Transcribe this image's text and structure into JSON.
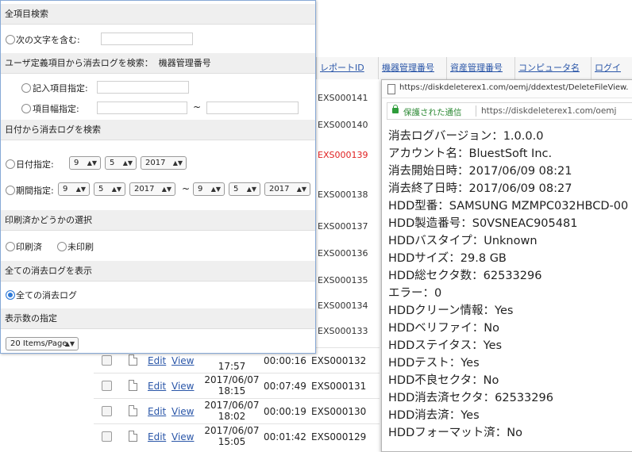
{
  "table": {
    "headers": [
      "レポートID",
      "機器管理番号",
      "資産管理番号",
      "コンピュータ名",
      "ログイ"
    ],
    "right_ids": [
      {
        "id": "EXS000141",
        "red": false
      },
      {
        "id": "EXS000140",
        "red": false
      },
      {
        "id": "EXS000139",
        "red": true
      },
      {
        "id": "EXS000138",
        "red": false
      },
      {
        "id": "EXS000137",
        "red": false
      },
      {
        "id": "EXS000136",
        "red": false
      },
      {
        "id": "EXS000135",
        "red": false
      },
      {
        "id": "EXS000134",
        "red": false
      },
      {
        "id": "EXS000133",
        "red": false
      },
      {
        "id": "EXS000132",
        "red": false
      }
    ],
    "partial_row": {
      "edit": "Edit",
      "view": "View",
      "date": "17:57",
      "duration": "00:00:16"
    },
    "rows": [
      {
        "edit": "Edit",
        "view": "View",
        "date": "2017/06/07",
        "time": "18:15",
        "duration": "00:07:49",
        "id": "EXS000131"
      },
      {
        "edit": "Edit",
        "view": "View",
        "date": "2017/06/07",
        "time": "18:02",
        "duration": "00:00:19",
        "id": "EXS000130"
      },
      {
        "edit": "Edit",
        "view": "View",
        "date": "2017/06/07",
        "time": "15:05",
        "duration": "00:01:42",
        "id": "EXS000129"
      }
    ]
  },
  "search": {
    "all_items": {
      "heading": "全項目検索",
      "contains_label": "次の文字を含む:"
    },
    "user_defined": {
      "heading": "ユーザ定義項目から消去ログを検索：",
      "field_name": "機器管理番号",
      "entry_label": "記入項目指定:",
      "range_label": "項目幅指定:",
      "tilde": "~"
    },
    "date": {
      "heading": "日付から消去ログを検索",
      "date_label": "日付指定:",
      "period_label": "期間指定:",
      "date_values": [
        "9",
        "5",
        "2017"
      ],
      "period_from": [
        "9",
        "5",
        "2017"
      ],
      "period_to": [
        "9",
        "5",
        "2017"
      ],
      "tilde": "~"
    },
    "print": {
      "heading": "印刷済かどうかの選択",
      "printed": "印刷済",
      "unprinted": "未印刷"
    },
    "show_all": {
      "heading": "全ての消去ログを表示",
      "option": "全ての消去ログ"
    },
    "page_size": {
      "heading": "表示数の指定",
      "value": "20 Items/Page"
    }
  },
  "popup": {
    "title": "https://diskdeleterex1.com/oemj/ddextest/DeleteFileView.",
    "secure": "保護された通信",
    "url": "https://diskdeleterex1.com/oemj",
    "lines": [
      "消去ログバージョン：1.0.0.0",
      "アカウント名：BluestSoft Inc.",
      "消去開始日時：2017/06/09 08:21",
      "消去終了日時：2017/06/09 08:27",
      "HDD型番：SAMSUNG MZMPC032HBCD-00",
      "HDD製造番号：S0VSNEAC905481",
      "HDDバスタイプ：Unknown",
      "HDDサイズ：29.8 GB",
      "HDD総セクタ数：62533296",
      "エラー：0",
      "HDDクリーン情報：Yes",
      "HDDベリファイ：No",
      "HDDステイタス：Yes",
      "HDDテスト：Yes",
      "HDD不良セクタ：No",
      "HDD消去済セクタ：62533296",
      "HDD消去済：Yes",
      "HDDフォーマット済：No"
    ]
  },
  "colors": {
    "link": "#2a56a8",
    "alert_id": "#e02020",
    "selected_radio": "#2f7ad8",
    "secure": "#2e8a36"
  }
}
